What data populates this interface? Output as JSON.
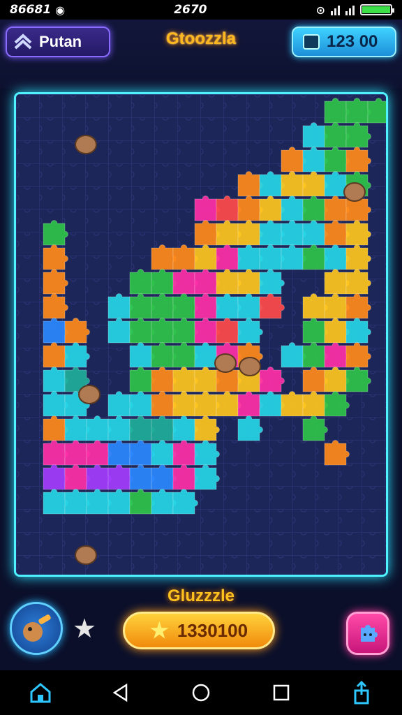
{
  "status_bar": {
    "left_text": "86681",
    "center_text": "2670"
  },
  "header": {
    "player_name": "Putan",
    "game_title": "Gtoozzla",
    "coins": "123 00"
  },
  "footer": {
    "label": "Gluzzzle",
    "score": "1330100"
  },
  "icons": {
    "back": "back-triangle-icon",
    "home": "home-circle-icon",
    "recent": "recent-square-icon"
  },
  "colors": {
    "board_border": "#4ef3ff",
    "title": "#ffb81e",
    "coins_button": "#2ec7ff",
    "score_button": "#f6a11a",
    "player_button": "#3a2a8a"
  }
}
